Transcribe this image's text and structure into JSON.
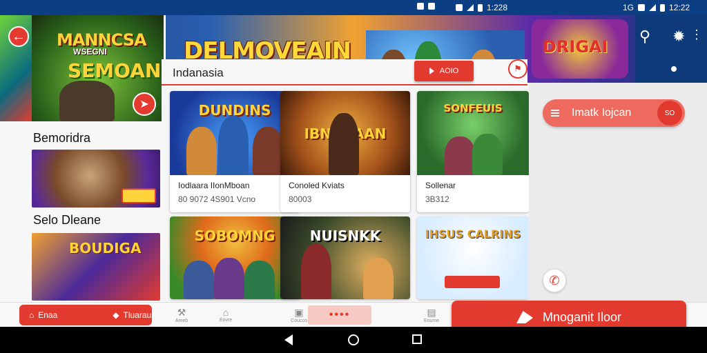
{
  "status_bar": {
    "left_time": "1:228",
    "right_signal": "1G",
    "right_time": "12:22"
  },
  "header": {
    "back_icon": "arrow-left-icon",
    "left_banner": {
      "line1": "MANNCSA",
      "line2": "WSEGNI",
      "line3": "SEMOAN"
    },
    "banner_title": "DELMOVEAIN",
    "right_logo": "DRIGAI",
    "search_icon": "search-icon",
    "settings_icon": "gear-icon",
    "more_icon": "more-vertical-icon"
  },
  "search": {
    "label": "Indanasia",
    "button_label": "AOIO",
    "mini_icon": "flag-icon"
  },
  "left_sections": [
    {
      "title": "Bemoridra"
    },
    {
      "title": "Selo Dleane",
      "card_title": "BOUDIGA"
    }
  ],
  "grid": {
    "cards": [
      {
        "thumb_title": "DUNDINS",
        "name": "Iodlaara IIonMboan",
        "meta": "80 9072 4S901 Vcno"
      },
      {
        "thumb_title": "IBNURAAN",
        "name": "Conoled Kviats",
        "meta": "80003"
      },
      {
        "thumb_title": "SONFEUIS",
        "name": "Sollenar",
        "meta": "3B312"
      },
      {
        "thumb_title": "SOBOMNG",
        "name": "",
        "meta": ""
      },
      {
        "thumb_title": "NUISNKK",
        "name": "",
        "meta": ""
      },
      {
        "thumb_title": "IHSUS CALRINS",
        "name": "",
        "meta": ""
      }
    ]
  },
  "right_panel": {
    "install_label": "Imatk Iojcan",
    "install_pill": "SO",
    "phone_icon": "phone-icon"
  },
  "bottom_nav": {
    "home_label": "Enaa",
    "home_secondary": "Tluaraus",
    "item2": "Ameb",
    "item3": "Eovre",
    "item4": "Coucco",
    "item5": "Enume",
    "more_label": "••••",
    "cta_label": "Mnoganit Iloor"
  },
  "colors": {
    "accent": "#e23a2e",
    "status_bar": "#0b3e82",
    "panel": "#ebebeb"
  }
}
